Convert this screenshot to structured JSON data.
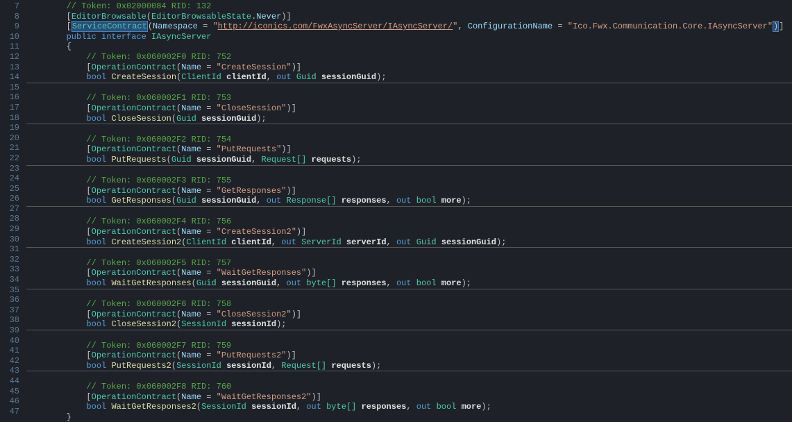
{
  "lines": [
    {
      "n": "7",
      "indent": 2,
      "type": "comment",
      "text": "// Token: 0x02000084 RID: 132"
    },
    {
      "n": "8",
      "indent": 2,
      "type": "attr1"
    },
    {
      "n": "9",
      "indent": 2,
      "type": "attr2"
    },
    {
      "n": "10",
      "indent": 2,
      "type": "iface"
    },
    {
      "n": "11",
      "indent": 2,
      "type": "brace",
      "text": "{"
    },
    {
      "n": "12",
      "indent": 3,
      "type": "comment",
      "text": "// Token: 0x060002F0 RID: 752"
    },
    {
      "n": "13",
      "indent": 3,
      "type": "op",
      "name": "CreateSession"
    },
    {
      "n": "14",
      "indent": 3,
      "type": "sig",
      "ret": "bool",
      "name": "CreateSession",
      "params": [
        [
          "ClientId",
          "clientId"
        ],
        [
          "out",
          "Guid",
          "sessionGuid"
        ]
      ]
    },
    {
      "n": "15",
      "type": "hr"
    },
    {
      "n": "16",
      "indent": 3,
      "type": "comment",
      "text": "// Token: 0x060002F1 RID: 753"
    },
    {
      "n": "17",
      "indent": 3,
      "type": "op",
      "name": "CloseSession"
    },
    {
      "n": "18",
      "indent": 3,
      "type": "sig",
      "ret": "bool",
      "name": "CloseSession",
      "params": [
        [
          "Guid",
          "sessionGuid"
        ]
      ]
    },
    {
      "n": "19",
      "type": "hr"
    },
    {
      "n": "20",
      "indent": 3,
      "type": "comment",
      "text": "// Token: 0x060002F2 RID: 754"
    },
    {
      "n": "21",
      "indent": 3,
      "type": "op",
      "name": "PutRequests"
    },
    {
      "n": "22",
      "indent": 3,
      "type": "sig",
      "ret": "bool",
      "name": "PutRequests",
      "params": [
        [
          "Guid",
          "sessionGuid"
        ],
        [
          "Request[]",
          "requests"
        ]
      ]
    },
    {
      "n": "23",
      "type": "hr"
    },
    {
      "n": "24",
      "indent": 3,
      "type": "comment",
      "text": "// Token: 0x060002F3 RID: 755"
    },
    {
      "n": "25",
      "indent": 3,
      "type": "op",
      "name": "GetResponses"
    },
    {
      "n": "26",
      "indent": 3,
      "type": "sig",
      "ret": "bool",
      "name": "GetResponses",
      "params": [
        [
          "Guid",
          "sessionGuid"
        ],
        [
          "out",
          "Response[]",
          "responses"
        ],
        [
          "out",
          "bool",
          "more"
        ]
      ]
    },
    {
      "n": "27",
      "type": "hr"
    },
    {
      "n": "28",
      "indent": 3,
      "type": "comment",
      "text": "// Token: 0x060002F4 RID: 756"
    },
    {
      "n": "29",
      "indent": 3,
      "type": "op",
      "name": "CreateSession2"
    },
    {
      "n": "30",
      "indent": 3,
      "type": "sig",
      "ret": "bool",
      "name": "CreateSession2",
      "params": [
        [
          "ClientId",
          "clientId"
        ],
        [
          "out",
          "ServerId",
          "serverId"
        ],
        [
          "out",
          "Guid",
          "sessionGuid"
        ]
      ]
    },
    {
      "n": "31",
      "type": "hr"
    },
    {
      "n": "32",
      "indent": 3,
      "type": "comment",
      "text": "// Token: 0x060002F5 RID: 757"
    },
    {
      "n": "33",
      "indent": 3,
      "type": "op",
      "name": "WaitGetResponses"
    },
    {
      "n": "34",
      "indent": 3,
      "type": "sig",
      "ret": "bool",
      "name": "WaitGetResponses",
      "params": [
        [
          "Guid",
          "sessionGuid"
        ],
        [
          "out",
          "byte[]",
          "responses"
        ],
        [
          "out",
          "bool",
          "more"
        ]
      ]
    },
    {
      "n": "35",
      "type": "hr"
    },
    {
      "n": "36",
      "indent": 3,
      "type": "comment",
      "text": "// Token: 0x060002F6 RID: 758"
    },
    {
      "n": "37",
      "indent": 3,
      "type": "op",
      "name": "CloseSession2"
    },
    {
      "n": "38",
      "indent": 3,
      "type": "sig",
      "ret": "bool",
      "name": "CloseSession2",
      "params": [
        [
          "SessionId",
          "sessionId"
        ]
      ]
    },
    {
      "n": "39",
      "type": "hr"
    },
    {
      "n": "40",
      "indent": 3,
      "type": "comment",
      "text": "// Token: 0x060002F7 RID: 759"
    },
    {
      "n": "41",
      "indent": 3,
      "type": "op",
      "name": "PutRequests2"
    },
    {
      "n": "42",
      "indent": 3,
      "type": "sig",
      "ret": "bool",
      "name": "PutRequests2",
      "params": [
        [
          "SessionId",
          "sessionId"
        ],
        [
          "Request[]",
          "requests"
        ]
      ]
    },
    {
      "n": "43",
      "type": "hr"
    },
    {
      "n": "44",
      "indent": 3,
      "type": "comment",
      "text": "// Token: 0x060002F8 RID: 760"
    },
    {
      "n": "45",
      "indent": 3,
      "type": "op",
      "name": "WaitGetResponses2"
    },
    {
      "n": "46",
      "indent": 3,
      "type": "sig",
      "ret": "bool",
      "name": "WaitGetResponses2",
      "params": [
        [
          "SessionId",
          "sessionId"
        ],
        [
          "out",
          "byte[]",
          "responses"
        ],
        [
          "out",
          "bool",
          "more"
        ]
      ]
    },
    {
      "n": "47",
      "indent": 2,
      "type": "brace",
      "text": "}"
    }
  ],
  "attr1": {
    "name": "EditorBrowsable",
    "argType": "EditorBrowsableState",
    "argVal": "Never"
  },
  "attr2": {
    "name": "ServiceContract",
    "ns": "Namespace",
    "url": "http://iconics.com/FwxAsyncServer/IAsyncServer/",
    "cn": "ConfigurationName",
    "cnVal": "Ico.Fwx.Communication.Core.IAsyncServer"
  },
  "iface": {
    "kw1": "public",
    "kw2": "interface",
    "name": "IAsyncServer"
  },
  "opAttr": {
    "name": "OperationContract",
    "prop": "Name"
  }
}
